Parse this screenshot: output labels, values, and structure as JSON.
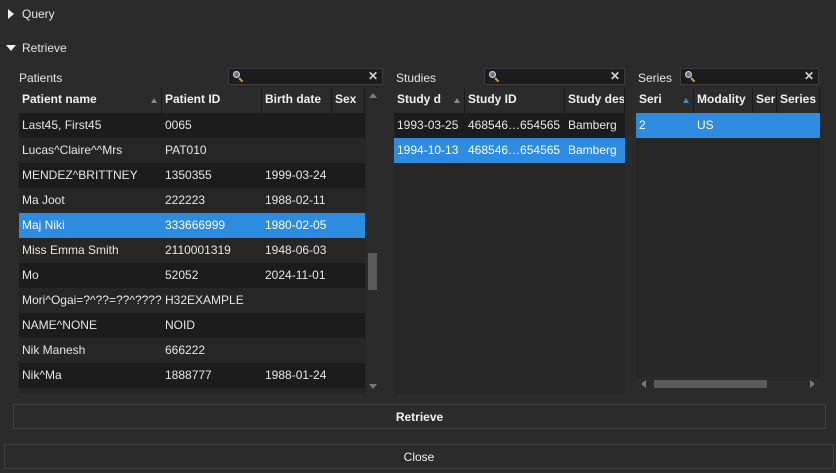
{
  "sections": {
    "query_label": "Query",
    "retrieve_label": "Retrieve"
  },
  "patients": {
    "label": "Patients",
    "search_placeholder": "",
    "columns": [
      "Patient name",
      "Patient ID",
      "Birth date",
      "Sex"
    ],
    "rows": [
      {
        "name": "Last45, First45",
        "id": "0065",
        "birth": "",
        "sex": ""
      },
      {
        "name": "Lucas^Claire^^Mrs",
        "id": "PAT010",
        "birth": "",
        "sex": ""
      },
      {
        "name": "MENDEZ^BRITTNEY",
        "id": "1350355",
        "birth": "1999-03-24",
        "sex": ""
      },
      {
        "name": "Ma Joot",
        "id": "222223",
        "birth": "1988-02-11",
        "sex": ""
      },
      {
        "name": "Maj Niki",
        "id": "333666999",
        "birth": "1980-02-05",
        "sex": ""
      },
      {
        "name": "Miss Emma Smith",
        "id": "2110001319",
        "birth": "1948-06-03",
        "sex": ""
      },
      {
        "name": "Mo",
        "id": "52052",
        "birth": "2024-11-01",
        "sex": ""
      },
      {
        "name": "Mori^Ogai=?^??=??^????",
        "id": "H32EXAMPLE",
        "birth": "",
        "sex": ""
      },
      {
        "name": "NAME^NONE",
        "id": "NOID",
        "birth": "",
        "sex": ""
      },
      {
        "name": "Nik Manesh",
        "id": "666222",
        "birth": "",
        "sex": ""
      },
      {
        "name": "Nik^Ma",
        "id": "1888777",
        "birth": "1988-01-24",
        "sex": ""
      }
    ],
    "selected_index": 4
  },
  "studies": {
    "label": "Studies",
    "search_placeholder": "",
    "columns": [
      "Study d",
      "Study ID",
      "Study des"
    ],
    "rows": [
      {
        "date": "1993-03-25",
        "id": "468546…654565",
        "desc": "Bamberg"
      },
      {
        "date": "1994-10-13",
        "id": "468546…654565",
        "desc": "Bamberg"
      }
    ],
    "selected_index": 1
  },
  "series": {
    "label": "Series",
    "search_placeholder": "",
    "columns": [
      "Seri",
      "Modality",
      "Ser",
      "Series t"
    ],
    "rows": [
      {
        "num": "2",
        "modality": "US",
        "ser": "",
        "series_t": ""
      }
    ],
    "selected_index": 0
  },
  "buttons": {
    "retrieve": "Retrieve",
    "close": "Close"
  },
  "icons": {
    "search": "search-icon",
    "clear": "clear-icon",
    "collapsed": "triangle-right-icon",
    "expanded": "triangle-down-icon"
  },
  "colors": {
    "background": "#2b2b2b",
    "selection": "#2d8ce0",
    "row_dark": "#1c1c1c",
    "row_light": "#262626"
  }
}
